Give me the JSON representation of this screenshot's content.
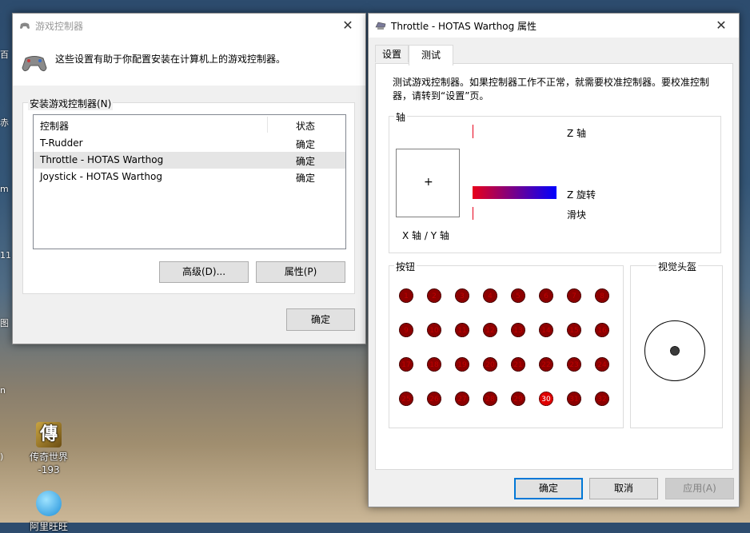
{
  "desktop": {
    "edge_labels": [
      "百",
      "赤",
      "m",
      "11",
      "图",
      "n",
      ")"
    ],
    "icons": [
      {
        "label": "传奇世界\n-193",
        "icon": "chuanqi-icon"
      },
      {
        "label": "阿里旺旺",
        "icon": "aliwangwang-icon"
      }
    ]
  },
  "game_controllers": {
    "title": "游戏控制器",
    "description": "这些设置有助于你配置安装在计算机上的游戏控制器。",
    "group_label": "安装游戏控制器(N)",
    "columns": [
      "控制器",
      "状态"
    ],
    "rows": [
      {
        "name": "T-Rudder",
        "status": "确定"
      },
      {
        "name": "Throttle - HOTAS Warthog",
        "status": "确定"
      },
      {
        "name": "Joystick - HOTAS Warthog",
        "status": "确定"
      }
    ],
    "selected_index": 1,
    "advanced_label": "高级(D)...",
    "properties_label": "属性(P)",
    "ok_label": "确定"
  },
  "properties": {
    "title": "Throttle - HOTAS Warthog 属性",
    "tabs": [
      {
        "label": "设置"
      },
      {
        "label": "测试"
      }
    ],
    "active_tab": 1,
    "description": "测试游戏控制器。如果控制器工作不正常，就需要校准控制器。要校准控制器，请转到“设置”页。",
    "axes_label": "轴",
    "xy_label": "X 轴 / Y 轴",
    "z_axis_label": "Z 轴",
    "z_rotation_label": "Z 旋转",
    "slider_label": "滑块",
    "z_rotation_fill": 1.0,
    "buttons_label": "按钮",
    "buttons": [
      "1",
      "2",
      "3",
      "4",
      "5",
      "6",
      "7",
      "8",
      "9",
      "10",
      "11",
      "12",
      "13",
      "14",
      "15",
      "16",
      "17",
      "18",
      "19",
      "20",
      "21",
      "22",
      "23",
      "24",
      "25",
      "26",
      "27",
      "28",
      "29",
      "30",
      "31",
      "32"
    ],
    "pressed_button": "30",
    "pov_label": "视觉头盔",
    "ok_label": "确定",
    "cancel_label": "取消",
    "apply_label": "应用(A)",
    "colors": {
      "axis_start": "#e8001a",
      "axis_end": "#0000ff",
      "button": "#8c0000",
      "button_pressed": "#e00000"
    }
  }
}
